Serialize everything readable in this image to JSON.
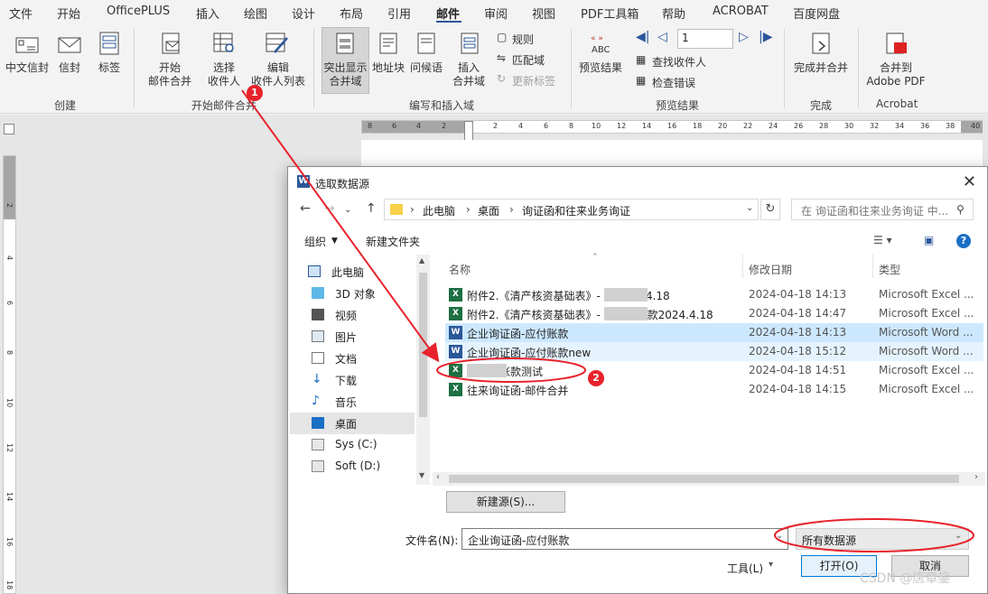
{
  "menubar": {
    "tabs": [
      "文件",
      "开始",
      "OfficePLUS",
      "插入",
      "绘图",
      "设计",
      "布局",
      "引用",
      "邮件",
      "审阅",
      "视图",
      "PDF工具箱",
      "帮助",
      "ACROBAT",
      "百度网盘"
    ],
    "active": "邮件"
  },
  "ribbon": {
    "create": {
      "group": "创建",
      "envelope_cn": "中文信封",
      "envelopes": "信封",
      "labels": "标签"
    },
    "start_merge": {
      "group": "开始邮件合并",
      "start": "开始\n邮件合并",
      "select": "选择\n收件人",
      "edit": "编辑\n收件人列表"
    },
    "write_insert": {
      "group": "编写和插入域",
      "highlight": "突出显示\n合并域",
      "address_block": "地址块",
      "greeting": "问候语",
      "insert_field": "插入\n合并域",
      "rules": "规则",
      "match_fields": "匹配域",
      "update_labels": "更新标签"
    },
    "preview": {
      "group": "预览结果",
      "preview_results": "预览结果",
      "abc": "ABC",
      "record": "1",
      "find_recipient": "查找收件人",
      "check_errors": "检查错误"
    },
    "finish": {
      "group": "完成",
      "finish_merge": "完成并合并"
    },
    "acrobat": {
      "group": "Acrobat",
      "merge_pdf": "合并到\nAdobe PDF"
    }
  },
  "ruler": {
    "h": [
      "8",
      "6",
      "4",
      "2",
      "2",
      "4",
      "6",
      "8",
      "10",
      "12",
      "14",
      "16",
      "18",
      "20",
      "22",
      "24",
      "26",
      "28",
      "30",
      "32",
      "34",
      "36",
      "38",
      "40"
    ],
    "v": [
      "2",
      "4",
      "6",
      "8",
      "10",
      "12",
      "14",
      "16",
      "18"
    ]
  },
  "dialog": {
    "title": "选取数据源",
    "breadcrumb": [
      "此电脑",
      "桌面",
      "询证函和往来业务询证"
    ],
    "search_placeholder": "在 询证函和往来业务询证 中...",
    "organize": "组织",
    "new_folder": "新建文件夹",
    "nav": [
      {
        "label": "此电脑",
        "icon": "computer-icon"
      },
      {
        "label": "3D 对象",
        "icon": "cube-icon"
      },
      {
        "label": "视频",
        "icon": "video-icon"
      },
      {
        "label": "图片",
        "icon": "picture-icon"
      },
      {
        "label": "文档",
        "icon": "document-icon"
      },
      {
        "label": "下载",
        "icon": "download-icon"
      },
      {
        "label": "音乐",
        "icon": "music-icon"
      },
      {
        "label": "桌面",
        "icon": "desktop-icon"
      },
      {
        "label": "Sys (C:)",
        "icon": "drive-icon"
      },
      {
        "label": "Soft (D:)",
        "icon": "drive-icon"
      }
    ],
    "columns": {
      "name": "名称",
      "date": "修改日期",
      "type": "类型"
    },
    "files": [
      {
        "name": "附件2.《清产核资基础表》-        友2024.4.18",
        "date": "2024-04-18 14:13",
        "type": "Microsoft Excel ...",
        "kind": "excel"
      },
      {
        "name": "附件2.《清产核资基础表》-        友应付账款2024.4.18",
        "date": "2024-04-18 14:47",
        "type": "Microsoft Excel ...",
        "kind": "excel"
      },
      {
        "name": "企业询证函-应付账款",
        "date": "2024-04-18 14:13",
        "type": "Microsoft Word ...",
        "kind": "word"
      },
      {
        "name": "企业询证函-应付账款new",
        "date": "2024-04-18 15:12",
        "type": "Microsoft Word ...",
        "kind": "word"
      },
      {
        "name": "       友应付账款测试",
        "date": "2024-04-18 14:51",
        "type": "Microsoft Excel ...",
        "kind": "excel"
      },
      {
        "name": "往来询证函-邮件合并",
        "date": "2024-04-18 14:15",
        "type": "Microsoft Excel ...",
        "kind": "excel"
      }
    ],
    "new_source": "新建源(S)...",
    "filename_label": "文件名(N):",
    "filename_value": "企业询证函-应付账款",
    "filetype_value": "所有数据源",
    "tools": "工具(L)",
    "open": "打开(O)",
    "cancel": "取消"
  },
  "annotations": {
    "step1": "1",
    "step2": "2"
  },
  "watermark": "CSDN @唐章鋆",
  "colors": {
    "accent": "#2b579a",
    "annotation": "#e8222b",
    "excel": "#1d6f42",
    "word": "#2b579a"
  }
}
